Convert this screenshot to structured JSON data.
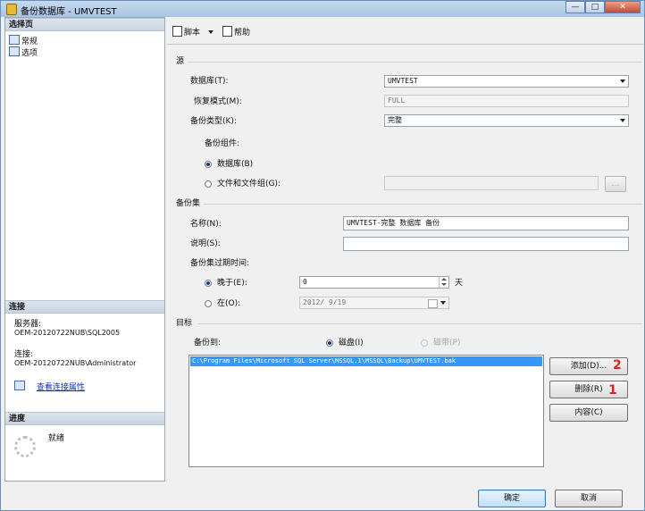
{
  "window": {
    "title": "备份数据库 - UMVTEST",
    "minimize": "—",
    "maximize": "□",
    "close": "✕"
  },
  "left_panel": {
    "select_page_title": "选择页",
    "pages": [
      {
        "label": "常规",
        "icon": "page-icon"
      },
      {
        "label": "选项",
        "icon": "page-icon"
      }
    ],
    "connection_title": "连接",
    "server_label": "服务器:",
    "server_value": "OEM-20120722NUB\\SQL2005",
    "connection_label": "连接:",
    "connection_value": "OEM-20120722NUB\\Administrator",
    "view_props_link": "查看连接属性",
    "progress_title": "进度",
    "progress_status": "就绪"
  },
  "toolbar": {
    "script_label": "脚本",
    "help_label": "帮助"
  },
  "source": {
    "group_title": "源",
    "database_label": "数据库(T):",
    "database_value": "UMVTEST",
    "recovery_label": "恢复模式(M):",
    "recovery_value": "FULL",
    "backup_type_label": "备份类型(K):",
    "backup_type_value": "完整",
    "component_label": "备份组件:",
    "component_database": "数据库(B)",
    "component_files": "文件和文件组(G):",
    "files_button": "..."
  },
  "backup_set": {
    "group_title": "备份集",
    "name_label": "名称(N):",
    "name_value": "UMVTEST-完整 数据库 备份",
    "desc_label": "说明(S):",
    "desc_value": "",
    "expire_label": "备份集过期时间:",
    "after_label": "晚于(E):",
    "after_value": "0",
    "after_unit": "天",
    "on_label": "在(O):",
    "on_value": "2012/ 9/19"
  },
  "destination": {
    "group_title": "目标",
    "backup_to_label": "备份到:",
    "disk_label": "磁盘(I)",
    "tape_label": "磁带(P)",
    "paths": [
      "C:\\Program Files\\Microsoft SQL Server\\MSSQL.1\\MSSQL\\Backup\\UMVTEST.bak"
    ],
    "add_button": "添加(D)...",
    "remove_button": "删除(R)",
    "contents_button": "内容(C)",
    "annotation_add": "2",
    "annotation_remove": "1"
  },
  "footer": {
    "ok_button": "确定",
    "cancel_button": "取消"
  }
}
